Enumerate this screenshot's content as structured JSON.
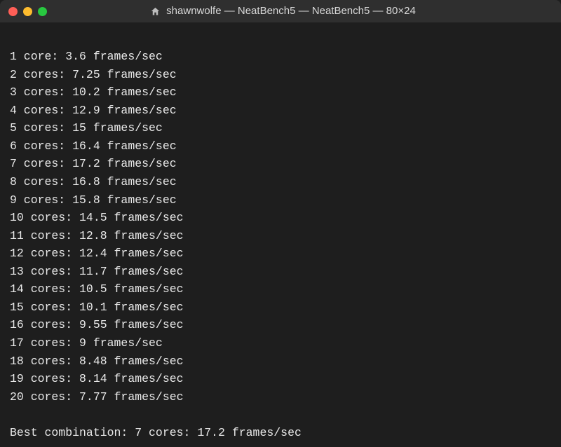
{
  "window": {
    "title": "shawnwolfe — NeatBench5 — NeatBench5 — 80×24"
  },
  "results": [
    {
      "cores": 1,
      "label": "core",
      "frames": "3.6"
    },
    {
      "cores": 2,
      "label": "cores",
      "frames": "7.25"
    },
    {
      "cores": 3,
      "label": "cores",
      "frames": "10.2"
    },
    {
      "cores": 4,
      "label": "cores",
      "frames": "12.9"
    },
    {
      "cores": 5,
      "label": "cores",
      "frames": "15"
    },
    {
      "cores": 6,
      "label": "cores",
      "frames": "16.4"
    },
    {
      "cores": 7,
      "label": "cores",
      "frames": "17.2"
    },
    {
      "cores": 8,
      "label": "cores",
      "frames": "16.8"
    },
    {
      "cores": 9,
      "label": "cores",
      "frames": "15.8"
    },
    {
      "cores": 10,
      "label": "cores",
      "frames": "14.5"
    },
    {
      "cores": 11,
      "label": "cores",
      "frames": "12.8"
    },
    {
      "cores": 12,
      "label": "cores",
      "frames": "12.4"
    },
    {
      "cores": 13,
      "label": "cores",
      "frames": "11.7"
    },
    {
      "cores": 14,
      "label": "cores",
      "frames": "10.5"
    },
    {
      "cores": 15,
      "label": "cores",
      "frames": "10.1"
    },
    {
      "cores": 16,
      "label": "cores",
      "frames": "9.55"
    },
    {
      "cores": 17,
      "label": "cores",
      "frames": "9"
    },
    {
      "cores": 18,
      "label": "cores",
      "frames": "8.48"
    },
    {
      "cores": 19,
      "label": "cores",
      "frames": "8.14"
    },
    {
      "cores": 20,
      "label": "cores",
      "frames": "7.77"
    }
  ],
  "best": {
    "prefix": "Best combination:",
    "cores": 7,
    "label": "cores",
    "frames": "17.2"
  }
}
